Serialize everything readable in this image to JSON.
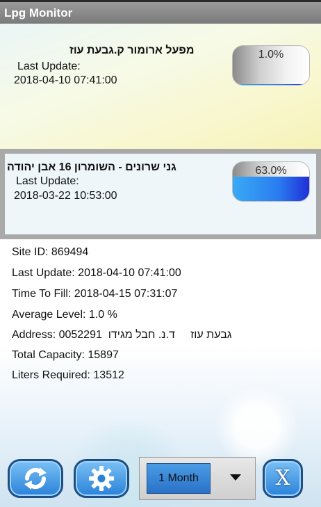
{
  "app": {
    "title": "Lpg Monitor"
  },
  "tanks": [
    {
      "name": "מפעל ארומור ק.גבעת עוז",
      "last_update_label": "Last Update:",
      "last_update": "2018-04-10 07:41:00",
      "level_text": "1.0%",
      "level_fraction": 0.01
    },
    {
      "name": "גני שרונים - השומרון 16 אבן יהודה",
      "last_update_label": "Last Update:",
      "last_update": "2018-03-22 10:53:00",
      "level_text": "63.0%",
      "level_fraction": 0.63
    }
  ],
  "details": {
    "site_id": "Site ID: 869494",
    "last_update": "Last Update: 2018-04-10 07:41:00",
    "time_to_fill": "Time To Fill: 2018-04-15 07:31:07",
    "average_level": "Average Level: 1.0 %",
    "address": "Address: 0052291  גבעת עוז     ד.נ. חבל מגידו",
    "total_capacity": "Total Capacity: 15897",
    "liters_required": "Liters Required: 13512"
  },
  "toolbar": {
    "refresh_icon": "refresh-icon",
    "settings_icon": "gear-icon",
    "period_value": "1 Month",
    "close_label": "X"
  },
  "colors": {
    "accent": "#2a82d8",
    "gauge_fill": "#2a7cf0",
    "titlebar": "#8a8a8a"
  }
}
